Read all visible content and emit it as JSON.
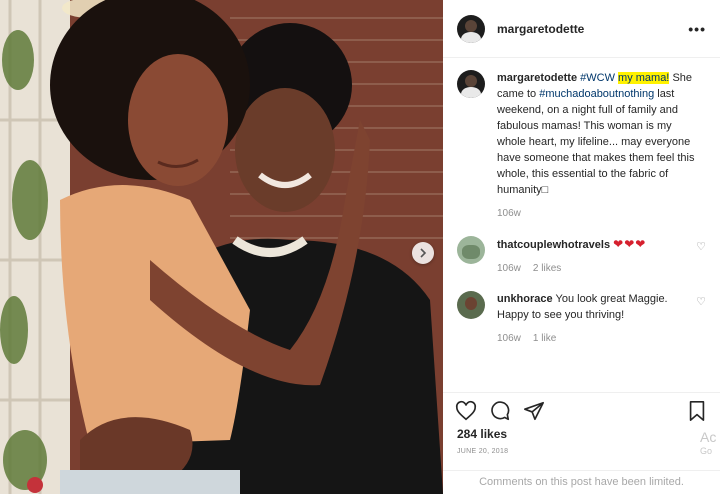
{
  "post": {
    "username": "margaretodette",
    "more_label": "•••",
    "caption": {
      "author": "margaretodette",
      "hashtag_wcw": "#WCW",
      "highlight": "my mama!",
      "text_before_hashtag": "She came to",
      "hashtag_event": "#muchadoaboutnothing",
      "text_after": "last weekend, on a night full of family and fabulous mamas! This woman is my whole heart, my lifeline... may everyone have someone that makes them feel this whole, this essential to the fabric of humanity□",
      "age": "106w"
    },
    "comments": [
      {
        "author": "thatcouplewhotravels",
        "text": "",
        "hearts": "❤❤❤",
        "age": "106w",
        "likes": "2 likes"
      },
      {
        "author": "unkhorace",
        "text": "You look great Maggie. Happy to see you thriving!",
        "hearts": "",
        "age": "106w",
        "likes": "1 like"
      }
    ],
    "likes": "284 likes",
    "date": "JUNE 20, 2018",
    "comments_limited": "Comments on this post have been limited.",
    "watermark_line1": "Ac",
    "watermark_line2": "Go"
  },
  "icons": {
    "like": "heart-outline-icon",
    "comment": "speech-bubble-icon",
    "share": "paper-plane-icon",
    "save": "bookmark-icon",
    "comment_like": "small-heart-icon",
    "next": "chevron-right-icon"
  },
  "colors": {
    "link": "#00376b",
    "highlight": "#fff200",
    "heart": "#d6202e",
    "muted": "#8e8e8e",
    "text": "#262626"
  }
}
